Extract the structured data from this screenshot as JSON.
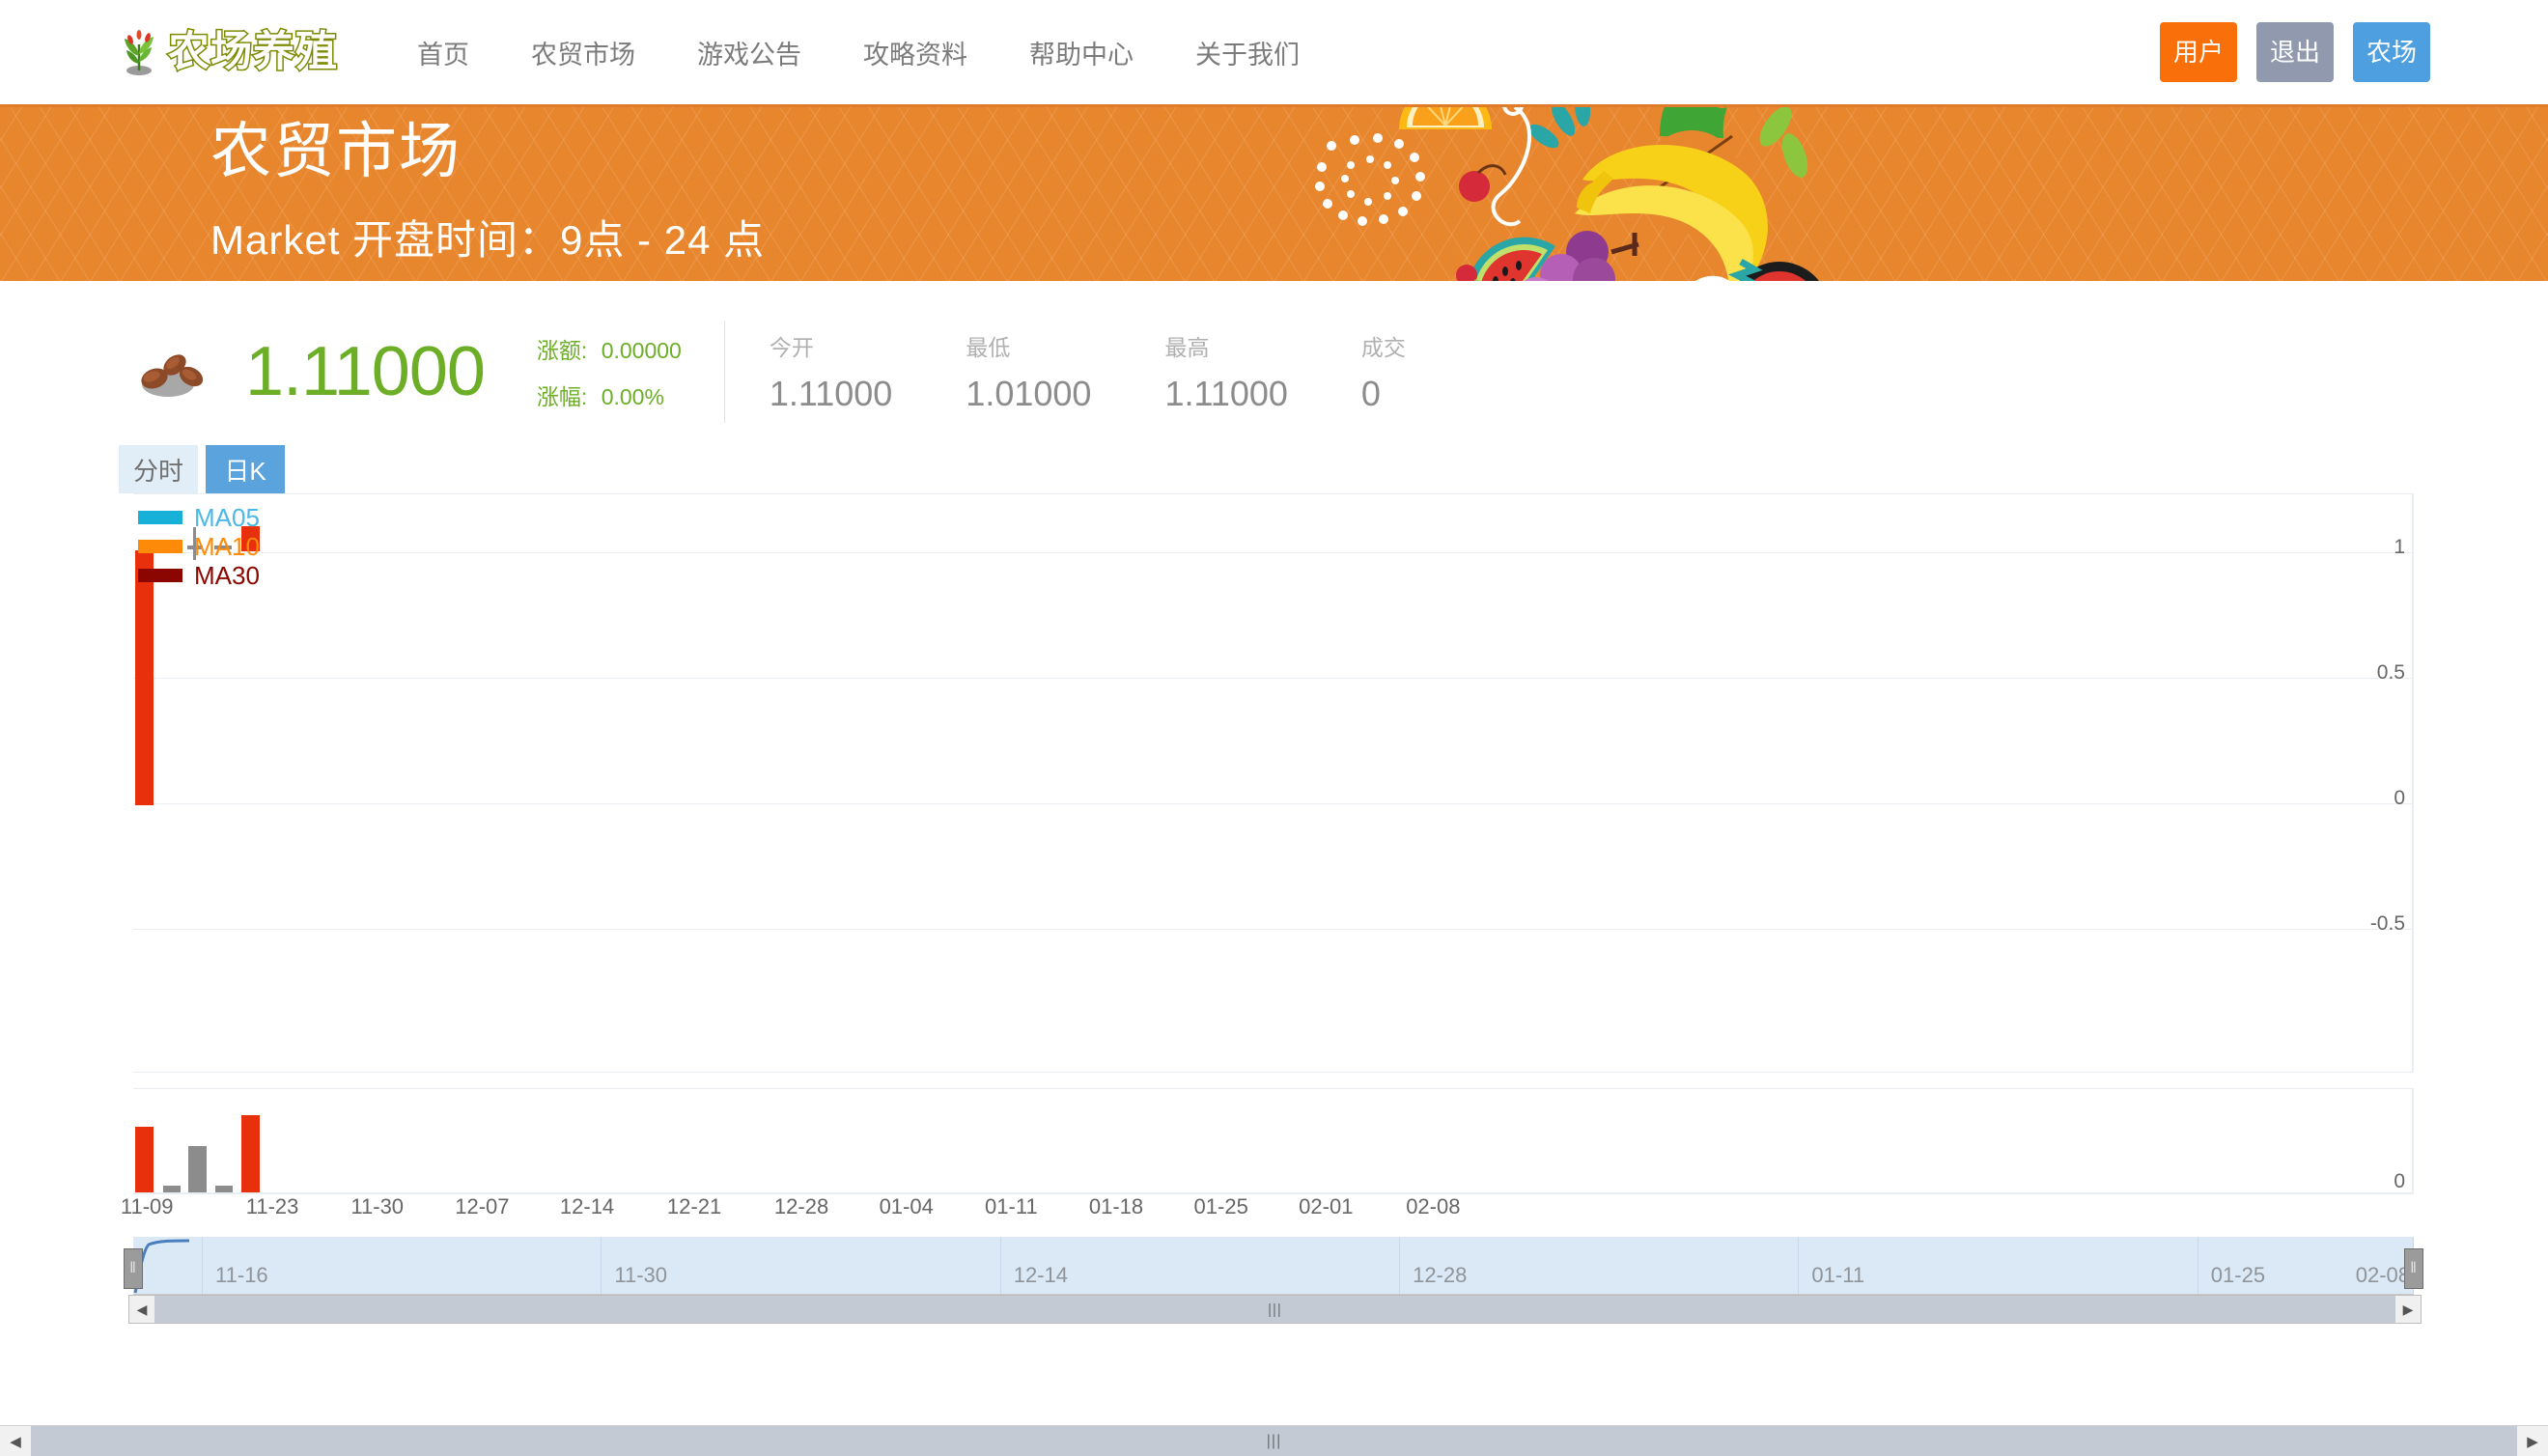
{
  "header": {
    "logo_text": "农场养殖",
    "logo_icon": "plant-icon",
    "nav": [
      {
        "label": "首页"
      },
      {
        "label": "农贸市场"
      },
      {
        "label": "游戏公告"
      },
      {
        "label": "攻略资料"
      },
      {
        "label": "帮助中心"
      },
      {
        "label": "关于我们"
      }
    ],
    "actions": {
      "user_label": "用户",
      "logout_label": "退出",
      "farm_label": "农场",
      "user_color": "#f96f09",
      "logout_color": "#9099ad",
      "farm_color": "#4d9fe0"
    }
  },
  "banner": {
    "title": "农贸市场",
    "subtitle": "Market 开盘时间：9点 - 24 点",
    "background_color": "#e8862e",
    "art_icon": "fruit-collage-illustration"
  },
  "quote": {
    "product_icon": "beans-icon",
    "price": "1.11000",
    "price_color": "#6cae26",
    "change_amount_label": "涨额:",
    "change_amount_value": "0.00000",
    "change_percent_label": "涨幅:",
    "change_percent_value": "0.00%",
    "stats": [
      {
        "label": "今开",
        "value": "1.11000"
      },
      {
        "label": "最低",
        "value": "1.01000"
      },
      {
        "label": "最高",
        "value": "1.11000"
      },
      {
        "label": "成交",
        "value": "0"
      }
    ]
  },
  "tabs": [
    {
      "label": "分时",
      "active": false
    },
    {
      "label": "日K",
      "active": true
    }
  ],
  "chart_data": {
    "type": "line",
    "title": "",
    "xlabel": "",
    "ylabel": "",
    "grid": true,
    "legend_position": "top-left",
    "legend": [
      {
        "name": "MA05",
        "color": "#16b0d8"
      },
      {
        "name": "MA10",
        "color": "#fd8b09"
      },
      {
        "name": "MA30",
        "color": "#8c0600"
      }
    ],
    "ylim": [
      -0.75,
      1.15
    ],
    "yticks": [
      "1",
      "0.5",
      "0",
      "-0.5"
    ],
    "ytick_values": [
      1,
      0.5,
      0,
      -0.5
    ],
    "xticks": [
      "11-09",
      "11-23",
      "11-30",
      "12-07",
      "12-14",
      "12-21",
      "12-28",
      "01-04",
      "01-11",
      "01-18",
      "01-25",
      "02-01",
      "02-08"
    ],
    "candles": [
      {
        "date": "11-09",
        "open": 1.0,
        "close": 0.0,
        "low": 0.0,
        "high": 1.05,
        "color": "#e8310c"
      },
      {
        "date": "11-10",
        "open": 1.0,
        "close": 1.0,
        "low": 1.0,
        "high": 1.0,
        "color": "#8c8c8c"
      },
      {
        "date": "11-11",
        "open": 1.0,
        "close": 1.0,
        "low": 0.98,
        "high": 1.07,
        "color": "#8c8c8c"
      },
      {
        "date": "11-12",
        "open": 1.0,
        "close": 1.0,
        "low": 1.0,
        "high": 1.0,
        "color": "#8c8c8c"
      },
      {
        "date": "11-13",
        "open": 1.0,
        "close": 1.11,
        "low": 1.0,
        "high": 1.11,
        "color": "#e8310c"
      }
    ],
    "volume": {
      "ylabel": "",
      "yticks": [
        "0"
      ],
      "bars": [
        {
          "date": "11-09",
          "value": 0.72,
          "color": "#e8310c"
        },
        {
          "date": "11-10",
          "value": 0.07,
          "color": "#8c8c8c"
        },
        {
          "date": "11-11",
          "value": 0.5,
          "color": "#8c8c8c"
        },
        {
          "date": "11-12",
          "value": 0.07,
          "color": "#8c8c8c"
        },
        {
          "date": "11-13",
          "value": 0.85,
          "color": "#e8310c"
        }
      ]
    }
  },
  "datazoom": {
    "ticks": [
      "11-16",
      "11-30",
      "12-14",
      "12-28",
      "01-11",
      "01-25",
      "02-08"
    ],
    "start_percent": 0,
    "end_percent": 100,
    "left_handle_icon": "drag-handle-icon",
    "right_handle_icon": "drag-handle-icon",
    "handle_glyph": "‖"
  },
  "scrollbars": {
    "chart_left_arrow": "◀",
    "chart_right_arrow": "▶",
    "chart_thumb_glyph": "|||",
    "page_left_arrow": "◀",
    "page_right_arrow": "▶",
    "page_thumb_glyph": "|||"
  }
}
